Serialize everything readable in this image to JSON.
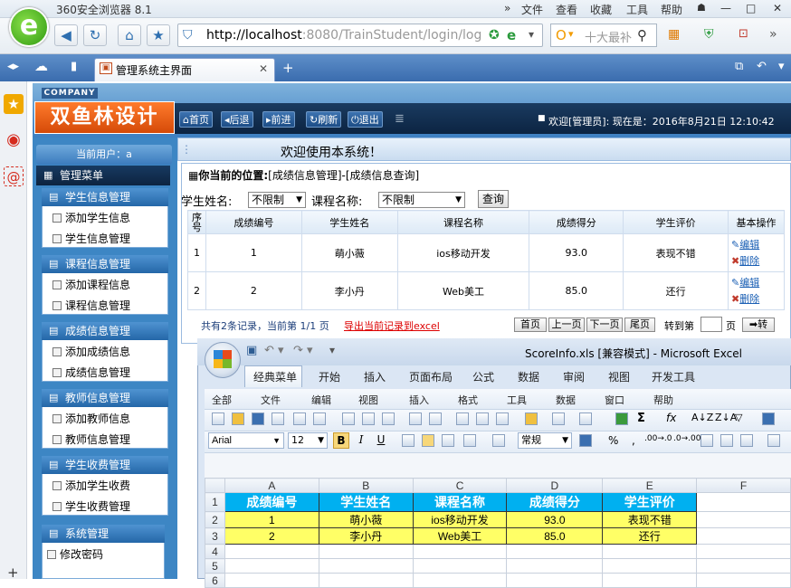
{
  "browser": {
    "title": "360安全浏览器 8.1",
    "menus": [
      "文件",
      "查看",
      "收藏",
      "工具",
      "帮助"
    ],
    "url_host": "http://localhost",
    "url_rest": ":8080/TrainStudent/login/log",
    "search_placeholder": "十大最补",
    "tab_title": "管理系统主界面"
  },
  "app": {
    "company": "COMPANY",
    "brand": "双鱼林设计",
    "toolbar": [
      "首页",
      "后退",
      "前进",
      "刷新",
      "退出"
    ],
    "welcome": "欢迎[管理员]:  现在是：2016年8月21日 12:10:42",
    "current_user": "当前用户：a",
    "main_menu": "管理菜单",
    "welcome_main": "欢迎使用本系统！",
    "groups": [
      {
        "title": "学生信息管理",
        "items": [
          "添加学生信息",
          "学生信息管理"
        ]
      },
      {
        "title": "课程信息管理",
        "items": [
          "添加课程信息",
          "课程信息管理"
        ]
      },
      {
        "title": "成绩信息管理",
        "items": [
          "添加成绩信息",
          "成绩信息管理"
        ]
      },
      {
        "title": "教师信息管理",
        "items": [
          "添加教师信息",
          "教师信息管理"
        ]
      },
      {
        "title": "学生收费管理",
        "items": [
          "添加学生收费",
          "学生收费管理"
        ]
      },
      {
        "title": "系统管理",
        "items": [
          "修改密码"
        ]
      }
    ]
  },
  "query": {
    "crumb_label": "你当前的位置:",
    "crumb_path": "[成绩信息管理]-[成绩信息查询]",
    "student_label": "学生姓名:",
    "student_value": "不限制",
    "course_label": "课程名称:",
    "course_value": "不限制",
    "query_btn": "查询",
    "headers": [
      "序号",
      "成绩编号",
      "学生姓名",
      "课程名称",
      "成绩得分",
      "学生评价",
      "基本操作"
    ],
    "rows": [
      {
        "no": "1",
        "id": "1",
        "name": "萌小薇",
        "course": "ios移动开发",
        "score": "93.0",
        "eval": "表现不错"
      },
      {
        "no": "2",
        "id": "2",
        "name": "李小丹",
        "course": "Web美工",
        "score": "85.0",
        "eval": "还行"
      }
    ],
    "edit": "编辑",
    "delete": "删除",
    "pager_info": "共有2条记录，当前第 1/1 页",
    "export": "导出当前记录到excel",
    "first": "首页",
    "prev": "上一页",
    "next": "下一页",
    "last": "尾页",
    "goto": "转到第",
    "page_unit": "页",
    "go": "转"
  },
  "excel": {
    "title": "ScoreInfo.xls [兼容模式] - Microsoft Excel",
    "ribbon_tabs": [
      "经典菜单",
      "开始",
      "插入",
      "页面布局",
      "公式",
      "数据",
      "审阅",
      "视图",
      "开发工具"
    ],
    "menu": [
      "全部",
      "文件",
      "编辑",
      "视图",
      "插入",
      "格式",
      "工具",
      "数据",
      "窗口",
      "帮助"
    ],
    "font": "Arial",
    "size": "12",
    "numfmt": "常规",
    "cols": [
      "A",
      "B",
      "C",
      "D",
      "E",
      "F"
    ],
    "header_row": [
      "成绩编号",
      "学生姓名",
      "课程名称",
      "成绩得分",
      "学生评价"
    ],
    "rows": [
      [
        "1",
        "萌小薇",
        "ios移动开发",
        "93.0",
        "表现不错"
      ],
      [
        "2",
        "李小丹",
        "Web美工",
        "85.0",
        "还行"
      ]
    ],
    "row_nums": [
      "1",
      "2",
      "3",
      "4",
      "5",
      "6"
    ]
  }
}
